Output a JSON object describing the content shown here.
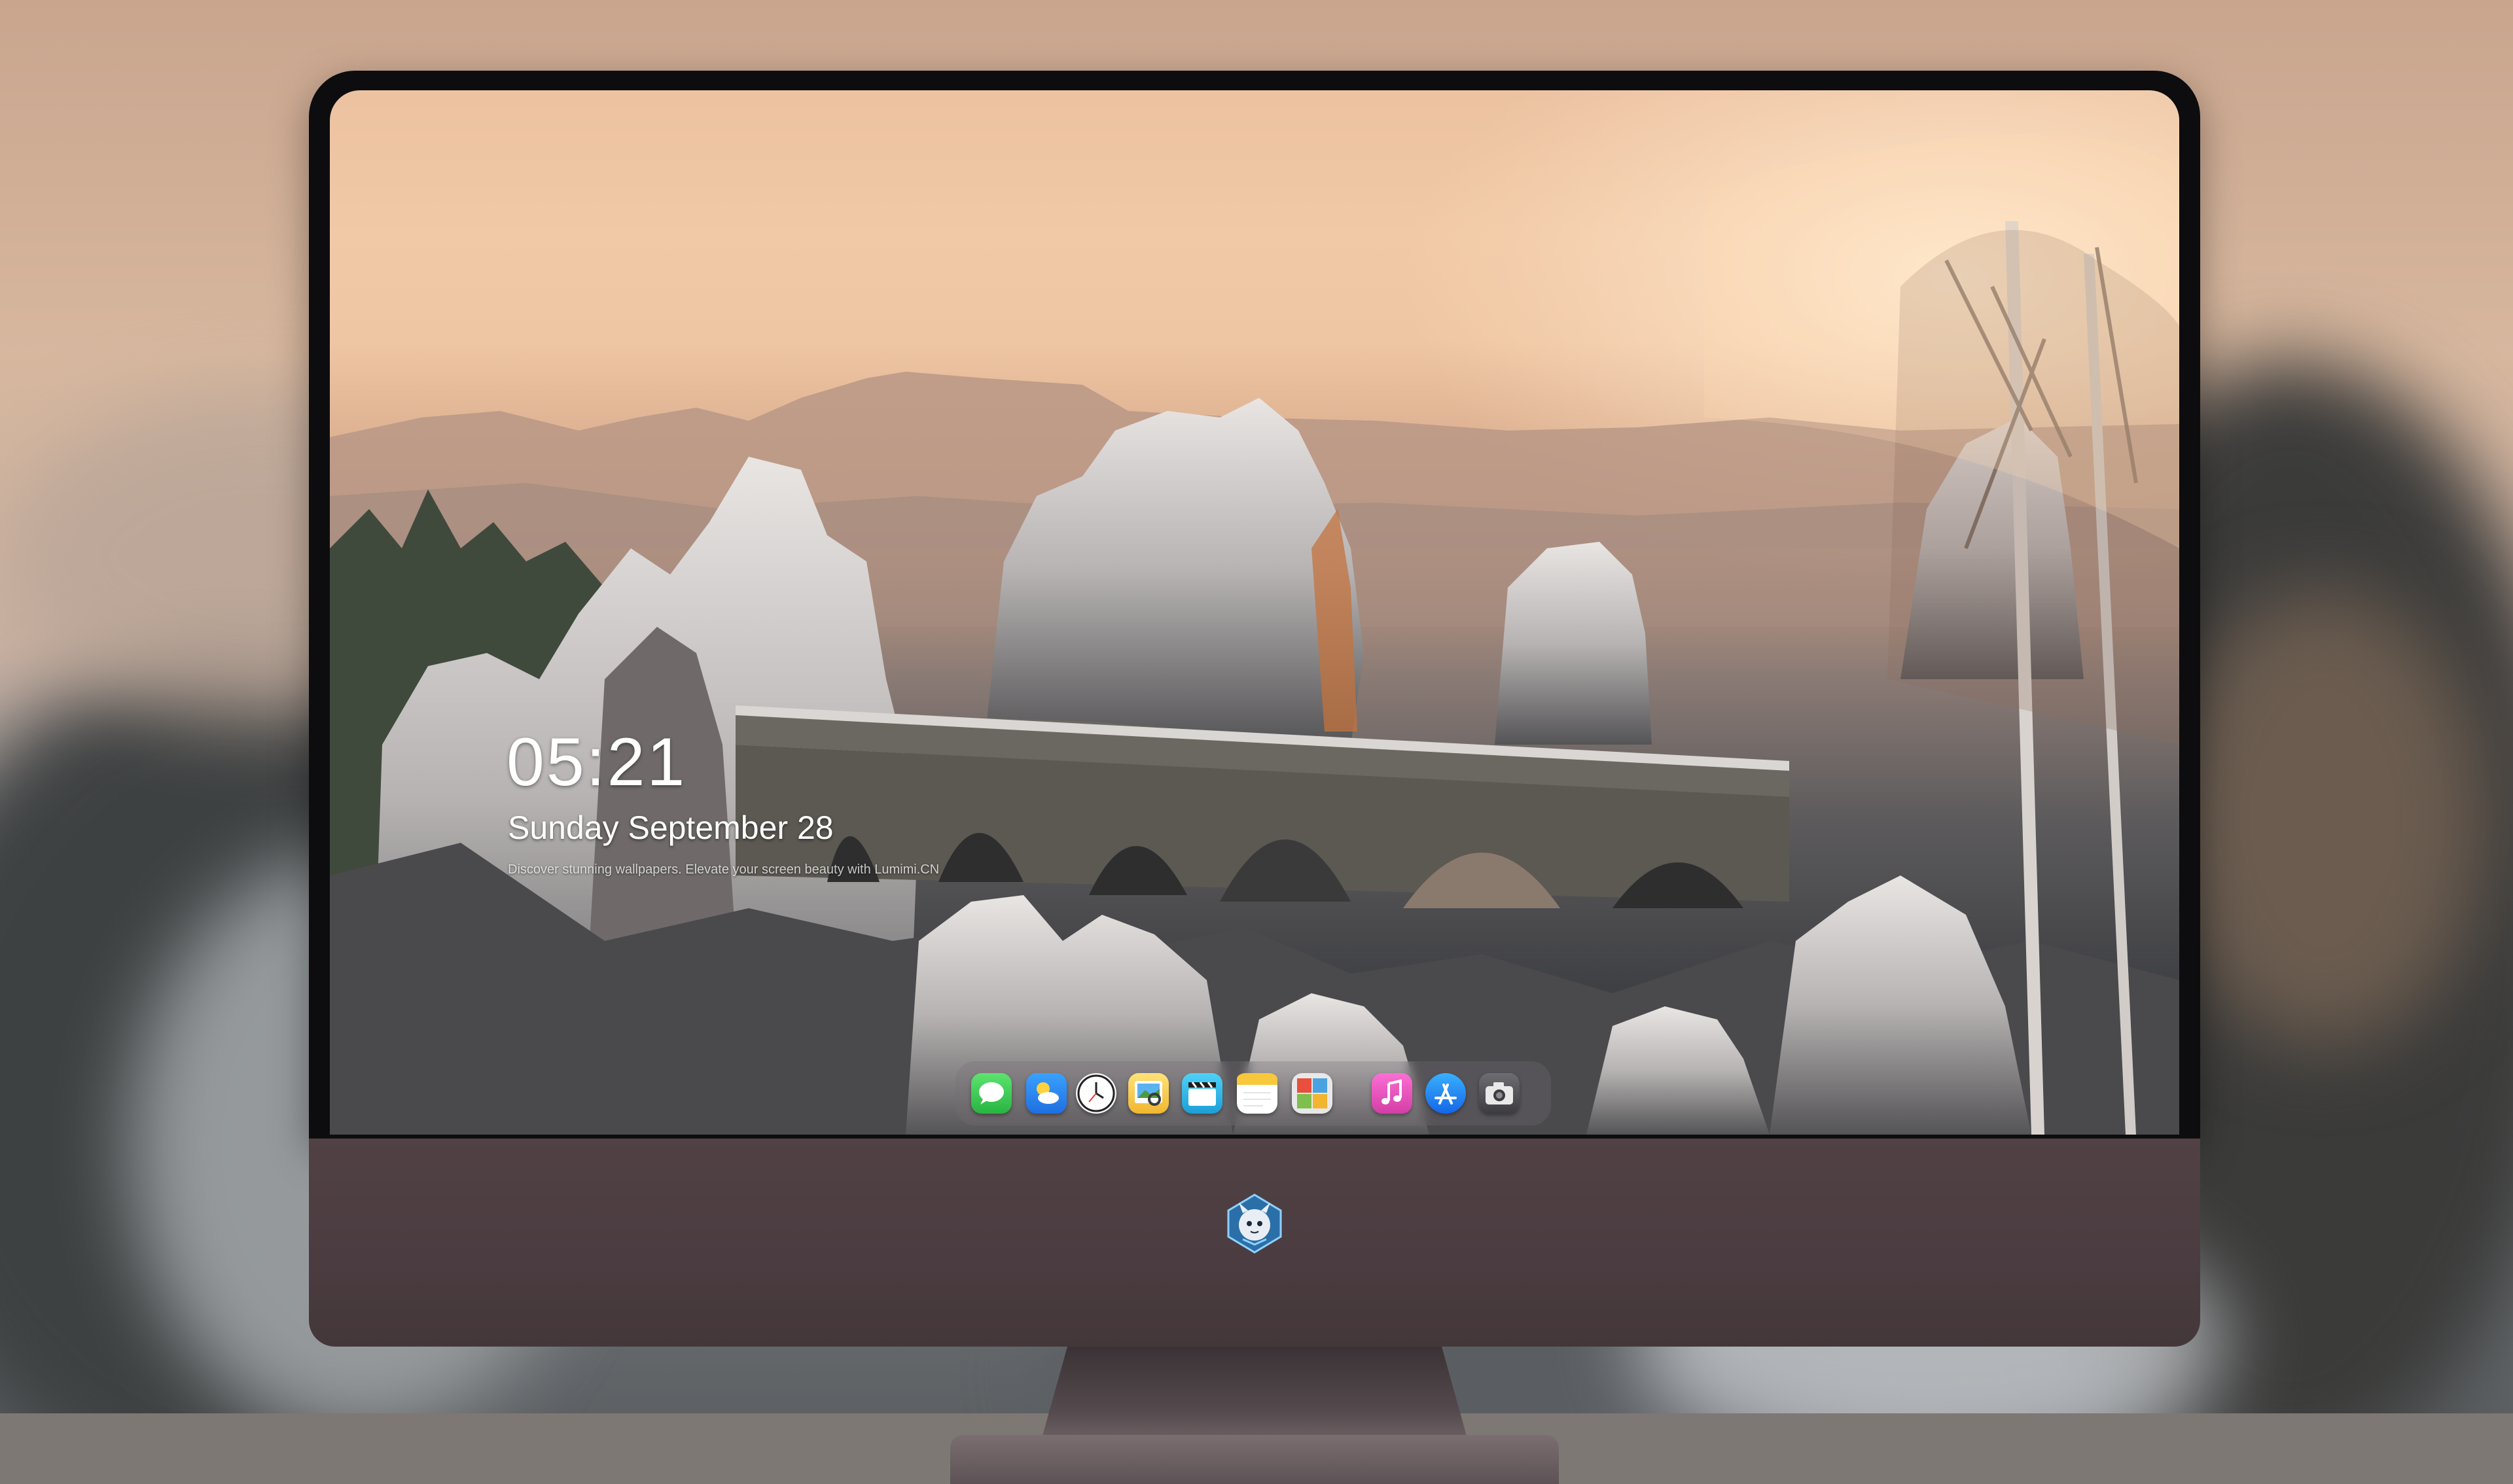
{
  "lock_screen": {
    "time": "05:21",
    "date": "Sunday September  28",
    "tagline": "Discover stunning wallpapers. Elevate your screen beauty with Lumimi.CN"
  },
  "dock": {
    "icons": [
      {
        "name": "messages-icon",
        "color": "#34c759"
      },
      {
        "name": "weather-icon",
        "color": "#2f8cf5"
      },
      {
        "name": "clock-icon",
        "color": "#f2f2f2"
      },
      {
        "name": "preview-icon",
        "color": "#f4c542"
      },
      {
        "name": "claquette-icon",
        "color": "#37b7e8"
      },
      {
        "name": "notes-icon",
        "color": "#f7d24a"
      },
      {
        "name": "photo-booth-icon",
        "color": "#7fbf4d"
      },
      {
        "name": "music-icon",
        "color": "#fa57c1"
      },
      {
        "name": "app-store-icon",
        "color": "#1d7cf2"
      },
      {
        "name": "camera-icon",
        "color": "#5c5c60"
      }
    ]
  },
  "chin": {
    "logo_icon": "mascot-logo-icon"
  }
}
